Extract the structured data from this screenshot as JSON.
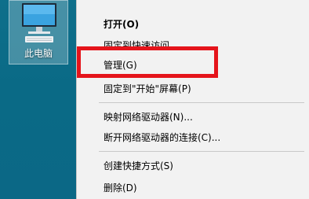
{
  "desktop": {
    "icon": {
      "name": "computer-icon",
      "label": "此电脑"
    }
  },
  "context_menu": {
    "items": [
      {
        "label": "打开(O)"
      },
      {
        "label": "固定到快速访问"
      },
      {
        "label": "管理(G)"
      },
      {
        "label": "固定到\"开始\"屏幕(P)"
      },
      {
        "label": "映射网络驱动器(N)..."
      },
      {
        "label": "断开网络驱动器的连接(C)..."
      },
      {
        "label": "创建快捷方式(S)"
      },
      {
        "label": "删除(D)"
      }
    ]
  },
  "annotation": {
    "highlight_color": "#e5141b",
    "highlighted_item": "管理(G)"
  }
}
